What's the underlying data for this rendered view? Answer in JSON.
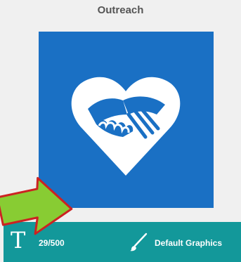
{
  "card": {
    "title": "Outreach"
  },
  "tile": {
    "icon": "heart-handshake-icon",
    "color": "#1a70c4"
  },
  "toolbar": {
    "background": "#13989a",
    "text_icon_glyph": "T",
    "char_count": "29/500",
    "graphics_label": "Default Graphics",
    "graphics_icon": "brush-icon"
  },
  "annotation": {
    "icon": "arrow-pointer-icon",
    "fill": "#88cc33",
    "stroke": "#cc2222"
  }
}
